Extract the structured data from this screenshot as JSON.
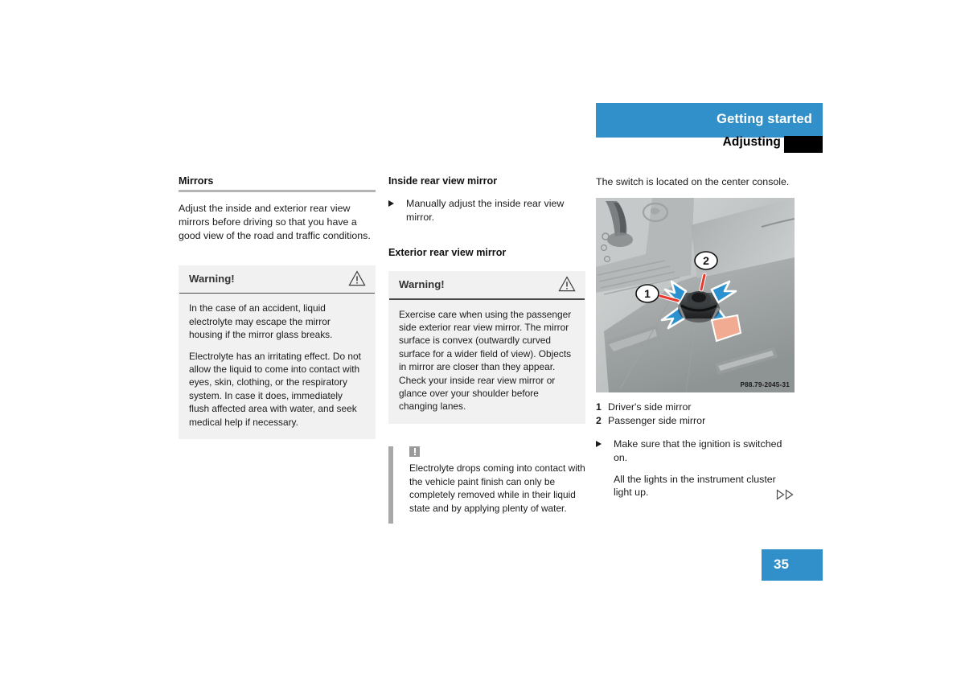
{
  "header": {
    "band_title": "Getting started",
    "sub_title": "Adjusting"
  },
  "columns": {
    "left": {
      "heading": "Mirrors",
      "intro": "Adjust the inside and exterior rear view mirrors before driving so that you have a good view of the road and traffic conditions.",
      "warning": {
        "label": "Warning!",
        "icon": "warning-triangle-icon",
        "paragraphs": [
          "In the case of an accident, liquid electrolyte may escape the mirror housing if the mirror glass breaks.",
          "Electrolyte has an irritating effect. Do not allow the liquid to come into contact with eyes, skin, clothing, or the respiratory system. In case it does, immediately flush affected area with water, and seek medical help if necessary."
        ]
      }
    },
    "middle": {
      "heading_inside": "Inside rear view mirror",
      "bullet_inside": "Manually adjust the inside rear view mirror.",
      "heading_exterior": "Exterior rear view mirror",
      "warning": {
        "label": "Warning!",
        "icon": "warning-triangle-icon",
        "paragraphs": [
          "Exercise care when using the passenger side exterior rear view mirror. The mirror surface is convex (outwardly curved surface for a wider field of view). Objects in mirror are closer than they appear. Check your inside rear view mirror or glance over your shoulder before changing lanes."
        ]
      },
      "notice": {
        "icon": "notice-exclamation-icon",
        "text": "Electrolyte drops coming into contact with the vehicle paint finish can only be completely removed while in their liquid state and by applying plenty of water."
      }
    },
    "right": {
      "intro": "The switch is located on the center console.",
      "figure": {
        "alt": "center-console-mirror-switch-photo",
        "code": "P88.79-2045-31",
        "callouts": [
          {
            "number": "1",
            "target": "driver-side-mirror-switch-position"
          },
          {
            "number": "2",
            "target": "passenger-side-mirror-switch-position"
          }
        ]
      },
      "legend": [
        {
          "num": "1",
          "label": "Driver's side mirror"
        },
        {
          "num": "2",
          "label": "Passenger side mirror"
        }
      ],
      "bullet": "Make sure that the ignition is switched on.",
      "bullet_sub": "All the lights in the instrument cluster light up.",
      "continuation_icon": "double-right-triangle-icon"
    }
  },
  "footer": {
    "page_number": "35"
  },
  "colors": {
    "accent_blue": "#3190c9",
    "tab_black": "#000000",
    "box_gray": "#f1f1f1",
    "rule_gray": "#b4b4b4",
    "notice_bar_gray": "#a8a8a8"
  }
}
